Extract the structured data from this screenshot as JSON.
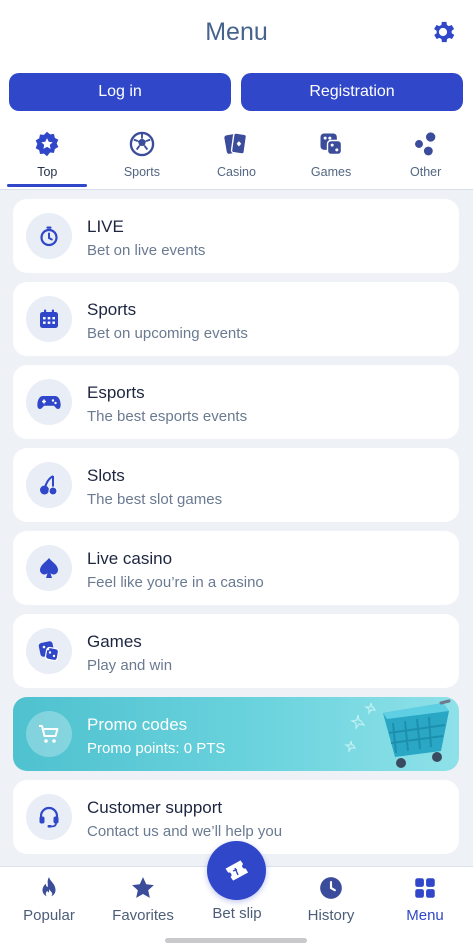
{
  "header": {
    "title": "Menu",
    "login_label": "Log in",
    "registration_label": "Registration"
  },
  "tabs": [
    {
      "label": "Top",
      "icon": "star-badge-icon",
      "active": true
    },
    {
      "label": "Sports",
      "icon": "ball-icon",
      "active": false
    },
    {
      "label": "Casino",
      "icon": "cards-icon",
      "active": false
    },
    {
      "label": "Games",
      "icon": "dice-icon",
      "active": false
    },
    {
      "label": "Other",
      "icon": "dots-icon",
      "active": false
    }
  ],
  "menu": {
    "items": [
      {
        "title": "LIVE",
        "subtitle": "Bet on live events",
        "icon": "stopwatch-icon"
      },
      {
        "title": "Sports",
        "subtitle": "Bet on upcoming events",
        "icon": "calendar-icon"
      },
      {
        "title": "Esports",
        "subtitle": "The best esports events",
        "icon": "gamepad-icon"
      },
      {
        "title": "Slots",
        "subtitle": "The best slot games",
        "icon": "cherries-icon"
      },
      {
        "title": "Live casino",
        "subtitle": "Feel like you’re in a casino",
        "icon": "spade-icon"
      },
      {
        "title": "Games",
        "subtitle": "Play and win",
        "icon": "dice-icon"
      }
    ],
    "promo": {
      "title": "Promo codes",
      "subtitle": "Promo points: 0 PTS",
      "icon": "cart-icon"
    },
    "support": {
      "title": "Customer support",
      "subtitle": "Contact us and we’ll help you",
      "icon": "headset-icon"
    }
  },
  "bottom_nav": [
    {
      "label": "Popular",
      "icon": "flame-icon",
      "active": false
    },
    {
      "label": "Favorites",
      "icon": "star-icon",
      "active": false
    },
    {
      "label": "Bet slip",
      "icon": "ticket-icon",
      "active": false
    },
    {
      "label": "History",
      "icon": "clock-icon",
      "active": false
    },
    {
      "label": "Menu",
      "icon": "grid-icon",
      "active": true
    }
  ],
  "colors": {
    "accent": "#2f47c8",
    "icon": "#2f47c8",
    "promo": "#5ac9d6"
  }
}
